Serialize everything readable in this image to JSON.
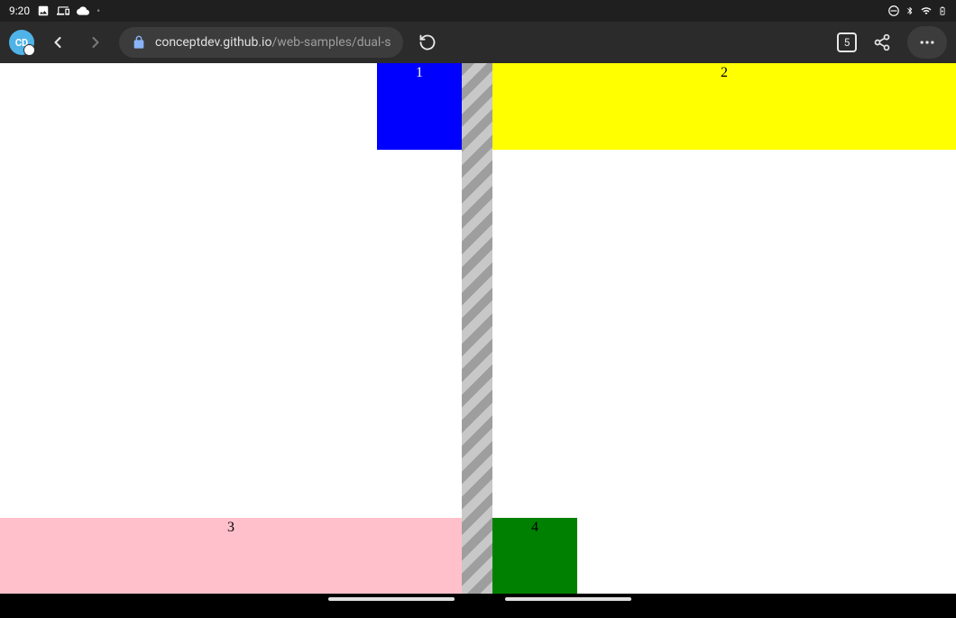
{
  "status": {
    "time": "9:20",
    "tab_count": "5"
  },
  "url": {
    "host": "conceptdev.github.io",
    "path": "/web-samples/dual-s"
  },
  "boxes": {
    "b1": "1",
    "b2": "2",
    "b3": "3",
    "b4": "4"
  },
  "profile": {
    "initials": "CD"
  }
}
